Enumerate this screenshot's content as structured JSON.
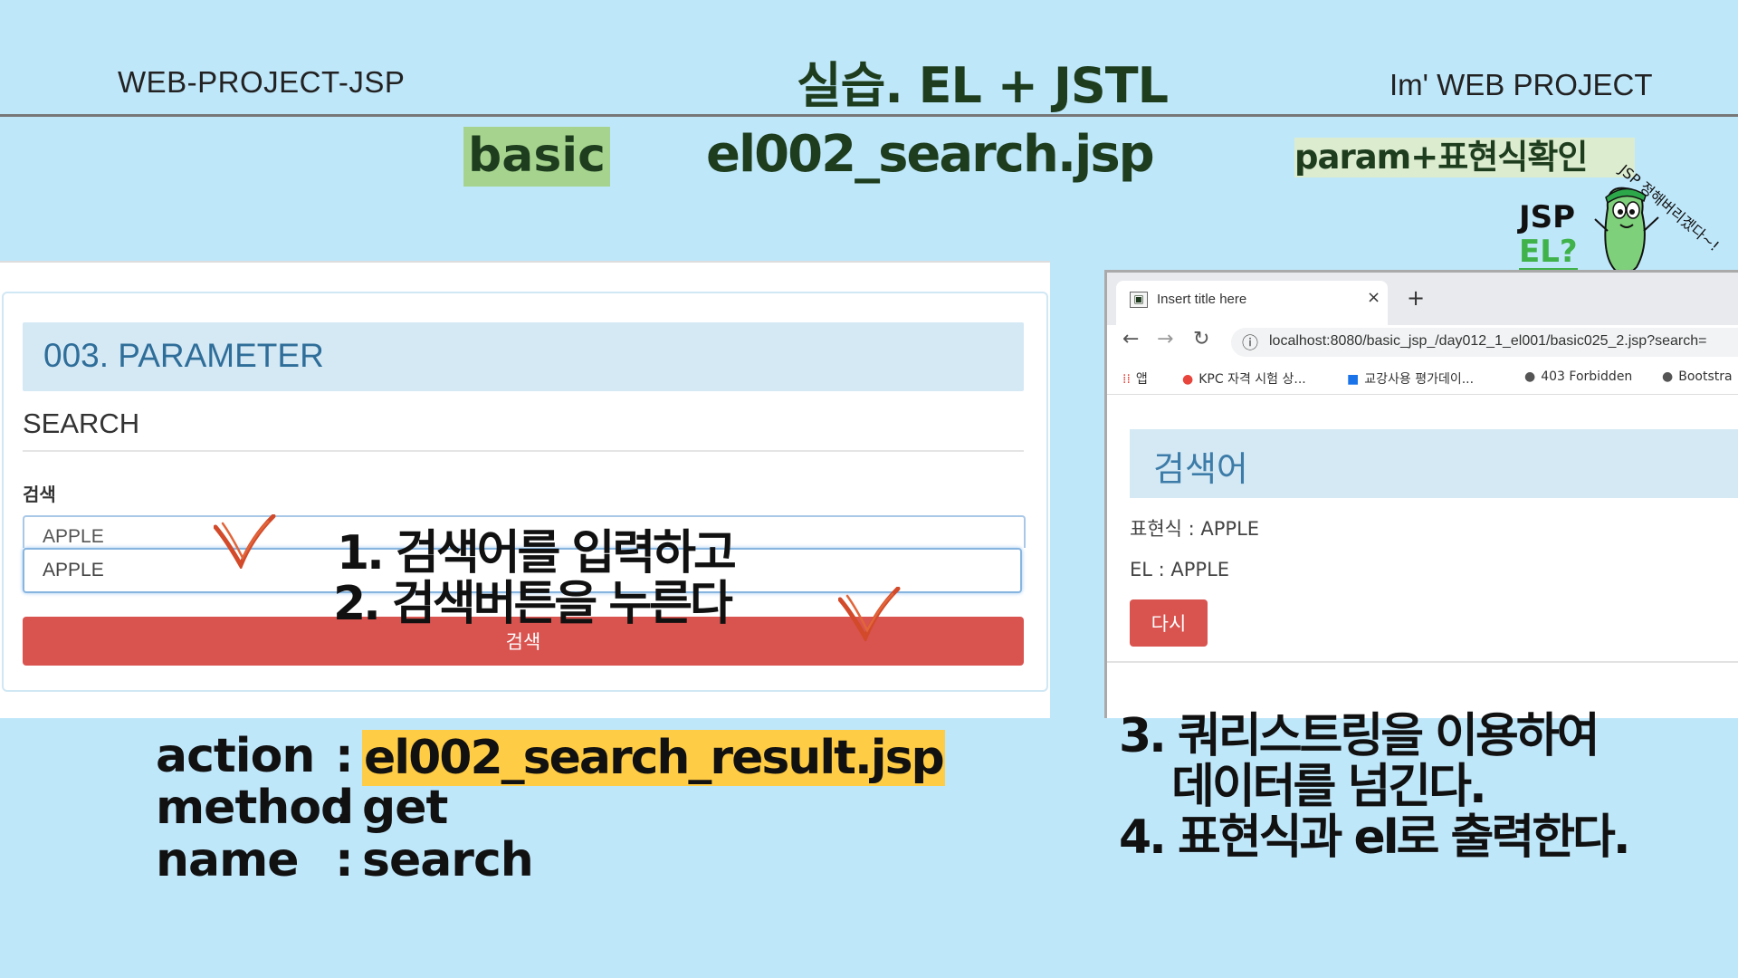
{
  "header": {
    "left": "WEB-PROJECT-JSP",
    "title": "실습. EL + JSTL",
    "right": "Im' WEB PROJECT"
  },
  "subheader": {
    "tag": "basic",
    "file": "el002_search.jsp",
    "note": "param+표현식확인"
  },
  "mascot": {
    "jsp": "JSP",
    "el": "EL?",
    "speech": "JSP 정해버리겠다~!"
  },
  "left_panel": {
    "section_title": "003. PARAMETER",
    "subtitle": "SEARCH",
    "field_label": "검색",
    "ghost_value": "APPLE",
    "input_value": "APPLE",
    "button_label": "검색"
  },
  "steps": {
    "step1": "1. 검색어를 입력하고",
    "step2": "2. 검색버튼을 누른다",
    "step3": "3. 쿼리스트링을 이용하여",
    "step3b": "데이터를 넘긴다.",
    "step4": "4. 표현식과 el로 출력한다."
  },
  "browser": {
    "tab_title": "Insert title here",
    "tab_close": "×",
    "new_tab": "+",
    "url": "localhost:8080/basic_jsp_/day012_1_el001/basic025_2.jsp?search=",
    "bookmarks": [
      "앱",
      "KPC 자격 시험 상...",
      "교강사용 평가데이...",
      "403 Forbidden",
      "Bootstra"
    ],
    "heading": "검색어",
    "expr_line": "표현식 : APPLE",
    "el_line": "EL : APPLE",
    "back_button": "다시"
  },
  "form_info": {
    "action_label": "action",
    "action_value": "el002_search_result.jsp",
    "method_label": "method",
    "method_value": "get",
    "name_label": "name",
    "name_value": "search",
    "colon": ":"
  },
  "colors": {
    "background": "#bfe7fa",
    "button_red": "#d9534f",
    "highlight_yellow": "#ffcc45",
    "tag_green": "#a6d48f"
  }
}
